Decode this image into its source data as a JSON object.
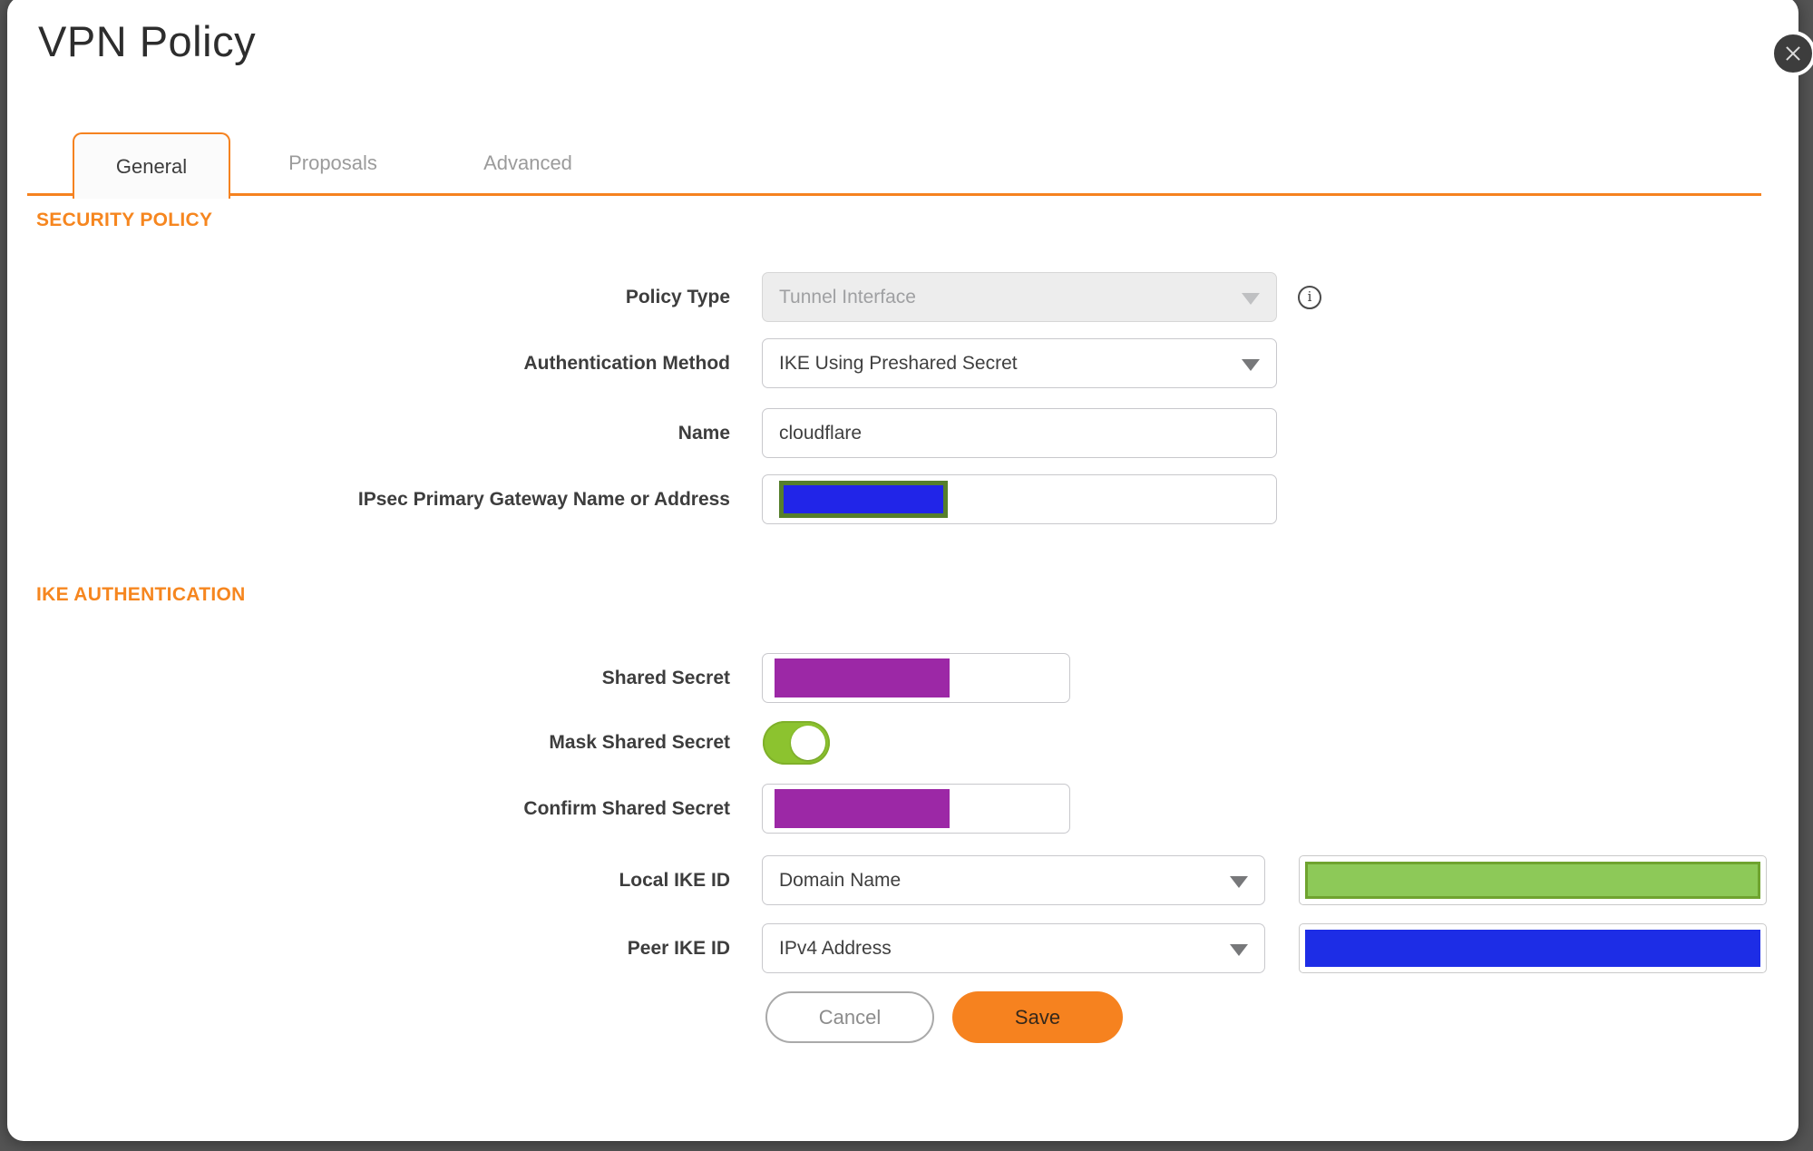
{
  "dialog": {
    "title": "VPN Policy"
  },
  "tabs": [
    {
      "label": "General",
      "active": true
    },
    {
      "label": "Proposals",
      "active": false
    },
    {
      "label": "Advanced",
      "active": false
    }
  ],
  "sections": {
    "security_policy": {
      "heading": "SECURITY POLICY"
    },
    "ike_authentication": {
      "heading": "IKE AUTHENTICATION"
    }
  },
  "fields": {
    "policy_type": {
      "label": "Policy Type",
      "value": "Tunnel Interface",
      "disabled": true
    },
    "auth_method": {
      "label": "Authentication Method",
      "value": "IKE Using Preshared Secret"
    },
    "name": {
      "label": "Name",
      "value": "cloudflare"
    },
    "gateway": {
      "label": "IPsec Primary Gateway Name or Address",
      "redacted": true
    },
    "shared_secret": {
      "label": "Shared Secret",
      "redacted": true
    },
    "mask_shared_secret": {
      "label": "Mask Shared Secret",
      "state": "on"
    },
    "confirm_shared_secret": {
      "label": "Confirm Shared Secret",
      "redacted": true
    },
    "local_ike_id": {
      "label": "Local IKE ID",
      "value": "Domain Name",
      "redacted_value": true
    },
    "peer_ike_id": {
      "label": "Peer IKE ID",
      "value": "IPv4 Address",
      "redacted_value": true
    }
  },
  "buttons": {
    "cancel": "Cancel",
    "save": "Save"
  },
  "colors": {
    "accent_orange": "#f5821f",
    "heading_orange": "#f6861f",
    "toggle_green": "#8cc32f",
    "redact_purple": "#9c28a6",
    "redact_blue": "#1d2de6",
    "redact_green_fill": "#8dc958",
    "redact_green_border": "#6fa32f",
    "redact_olive_border": "#567f2b",
    "backdrop": "#545454",
    "save_button": "#f6821f"
  }
}
